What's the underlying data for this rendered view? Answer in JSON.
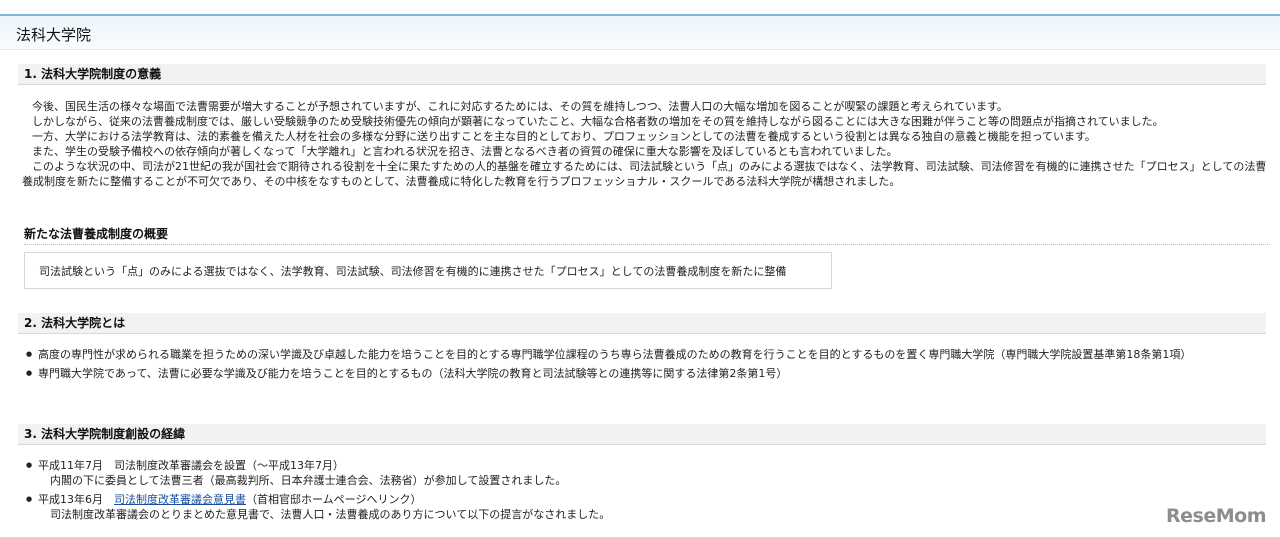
{
  "page_title": "法科大学院",
  "section1": {
    "heading": "1. 法科大学院制度の意義",
    "paragraphs": [
      "今後、国民生活の様々な場面で法曹需要が増大することが予想されていますが、これに対応するためには、その質を維持しつつ、法曹人口の大幅な増加を図ることが喫緊の課題と考えられています。",
      "しかしながら、従来の法曹養成制度では、厳しい受験競争のため受験技術優先の傾向が顕著になっていたこと、大幅な合格者数の増加をその質を維持しながら図ることには大きな困難が伴うこと等の問題点が指摘されていました。",
      "一方、大学における法学教育は、法的素養を備えた人材を社会の多様な分野に送り出すことを主な目的としており、プロフェッションとしての法曹を養成するという役割とは異なる独自の意義と機能を担っています。",
      "また、学生の受験予備校への依存傾向が著しくなって「大学離れ」と言われる状況を招き、法曹となるべき者の資質の確保に重大な影響を及ぼしているとも言われていました。",
      "このような状況の中、司法が21世紀の我が国社会で期待される役割を十全に果たすための人的基盤を確立するためには、司法試験という「点」のみによる選抜ではなく、法学教育、司法試験、司法修習を有機的に連携させた「プロセス」としての法曹養成制度を新たに整備することが不可欠であり、その中核をなすものとして、法曹養成に特化した教育を行うプロフェッショナル・スクールである法科大学院が構想されました。"
    ]
  },
  "overview": {
    "heading": "新たな法曹養成制度の概要",
    "text": "司法試験という「点」のみによる選抜ではなく、法学教育、司法試験、司法修習を有機的に連携させた「プロセス」としての法曹養成制度を新たに整備"
  },
  "section2": {
    "heading": "2. 法科大学院とは",
    "items": [
      "高度の専門性が求められる職業を担うための深い学識及び卓越した能力を培うことを目的とする専門職学位課程のうち専ら法曹養成のための教育を行うことを目的とするものを置く専門職大学院（専門職大学院設置基準第18条第1項）",
      "専門職大学院であって、法曹に必要な学識及び能力を培うことを目的とするもの（法科大学院の教育と司法試験等との連携等に関する法律第2条第1号）"
    ]
  },
  "section3": {
    "heading": "3. 法科大学院制度創設の経緯",
    "items": [
      {
        "line": "平成11年7月　司法制度改革審議会を設置（〜平成13年7月）",
        "sub": "内閣の下に委員として法曹三者（最高裁判所、日本弁護士連合会、法務省）が参加して設置されました。"
      },
      {
        "line_prefix": "平成13年6月　",
        "link": "司法制度改革審議会意見書",
        "line_suffix": "（首相官邸ホームページへリンク）",
        "sub": "司法制度改革審議会のとりまとめた意見書で、法曹人口・法曹養成のあり方について以下の提言がなされました。"
      }
    ]
  },
  "watermark": "ReseMom"
}
